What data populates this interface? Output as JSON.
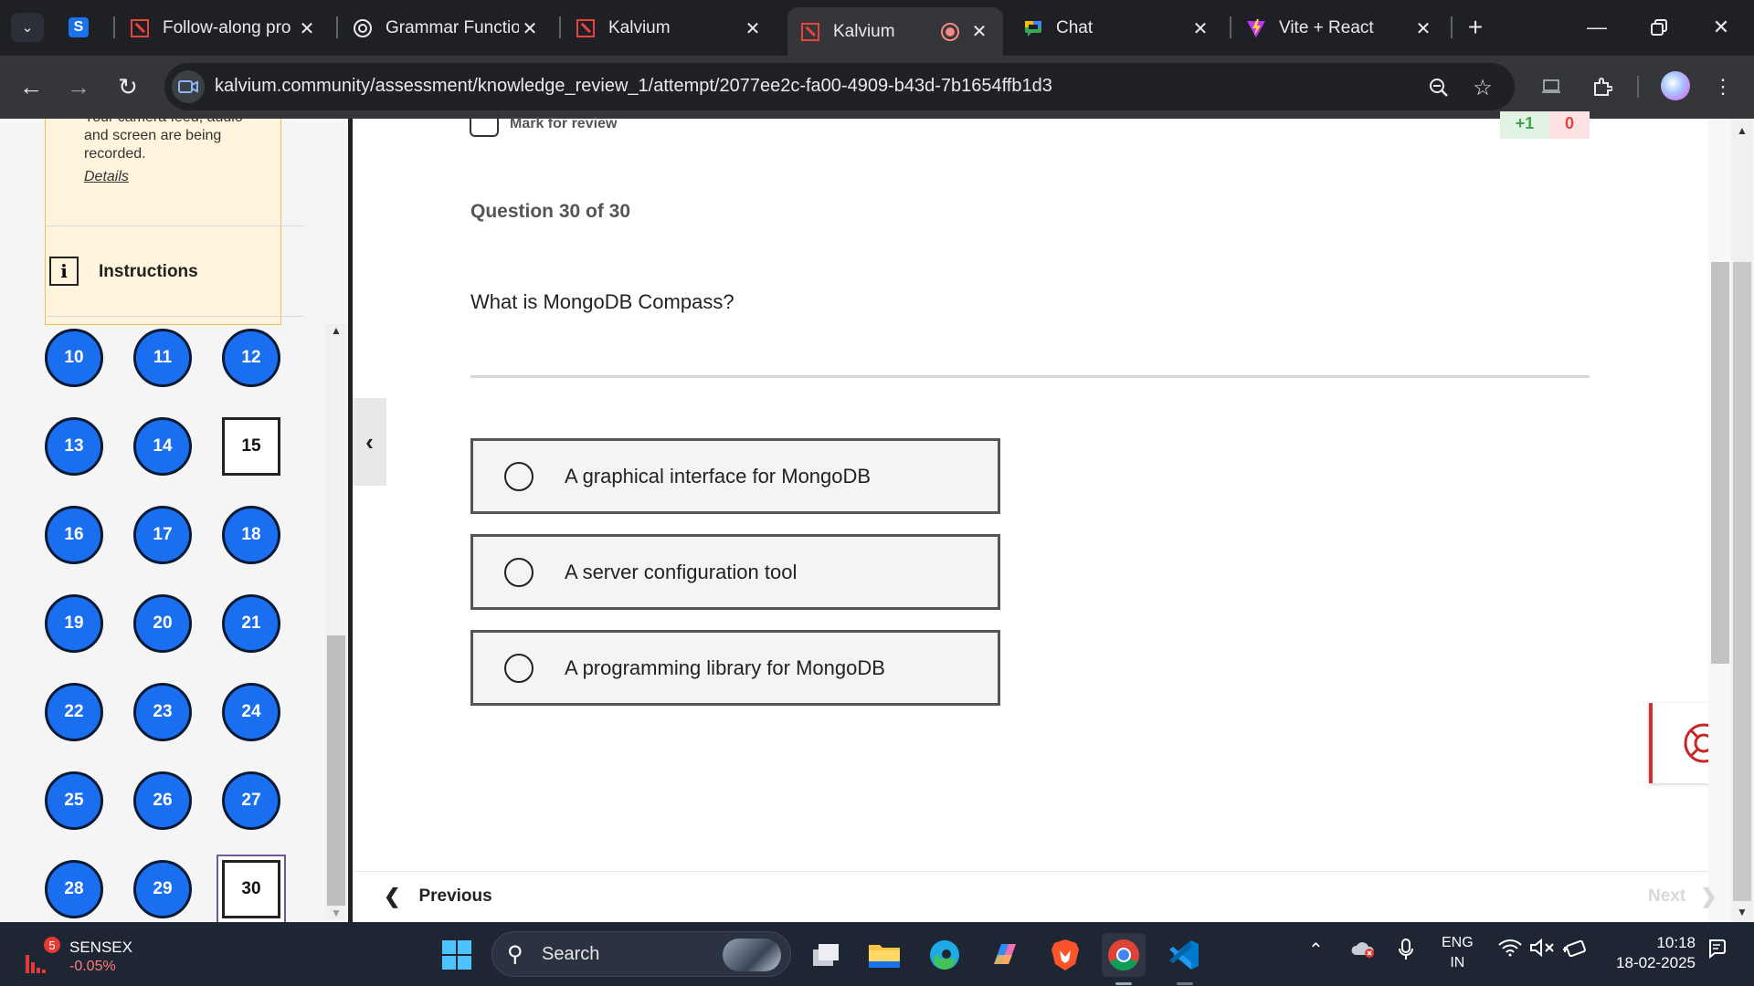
{
  "browser": {
    "tabs": [
      {
        "title": "Follow-along pro"
      },
      {
        "title": "Grammar Functio"
      },
      {
        "title": "Kalvium"
      },
      {
        "title": "Kalvium"
      },
      {
        "title": "Chat"
      },
      {
        "title": "Vite + React"
      }
    ],
    "url": "kalvium.community/assessment/knowledge_review_1/attempt/2077ee2c-fa00-4909-b43d-7b1654ffb1d3",
    "tab_close_glyph": "✕"
  },
  "sidebar": {
    "recording_notice": "Your camera feed, audio and screen are being recorded.",
    "details_link": "Details",
    "instructions_label": "Instructions",
    "questions": [
      {
        "n": "10",
        "state": "answered"
      },
      {
        "n": "11",
        "state": "answered"
      },
      {
        "n": "12",
        "state": "answered"
      },
      {
        "n": "13",
        "state": "answered"
      },
      {
        "n": "14",
        "state": "answered"
      },
      {
        "n": "15",
        "state": "unanswered"
      },
      {
        "n": "16",
        "state": "answered"
      },
      {
        "n": "17",
        "state": "answered"
      },
      {
        "n": "18",
        "state": "answered"
      },
      {
        "n": "19",
        "state": "answered"
      },
      {
        "n": "20",
        "state": "answered"
      },
      {
        "n": "21",
        "state": "answered"
      },
      {
        "n": "22",
        "state": "answered"
      },
      {
        "n": "23",
        "state": "answered"
      },
      {
        "n": "24",
        "state": "answered"
      },
      {
        "n": "25",
        "state": "answered"
      },
      {
        "n": "26",
        "state": "answered"
      },
      {
        "n": "27",
        "state": "answered"
      },
      {
        "n": "28",
        "state": "answered"
      },
      {
        "n": "29",
        "state": "answered"
      },
      {
        "n": "30",
        "state": "current"
      }
    ]
  },
  "question": {
    "mark_for_review": "Mark for review",
    "score_plus": "+1",
    "score_minus": "0",
    "counter": "Question 30 of 30",
    "text": "What is MongoDB Compass?",
    "options": [
      "A graphical interface for MongoDB",
      "A server configuration tool",
      "A programming library for MongoDB"
    ]
  },
  "footer": {
    "previous": "Previous",
    "next": "Next"
  },
  "taskbar": {
    "stock_badge": "5",
    "stock_name": "SENSEX",
    "stock_change": "-0.05%",
    "search_label": "Search",
    "lang_top": "ENG",
    "lang_bottom": "IN",
    "time": "10:18",
    "date": "18-02-2025"
  },
  "colors": {
    "answered": "#1a6ef0",
    "tabstrip": "#1e2026",
    "toolbar": "#35363a",
    "taskbar": "#1f2633",
    "warning_bg": "#fff4dc"
  }
}
